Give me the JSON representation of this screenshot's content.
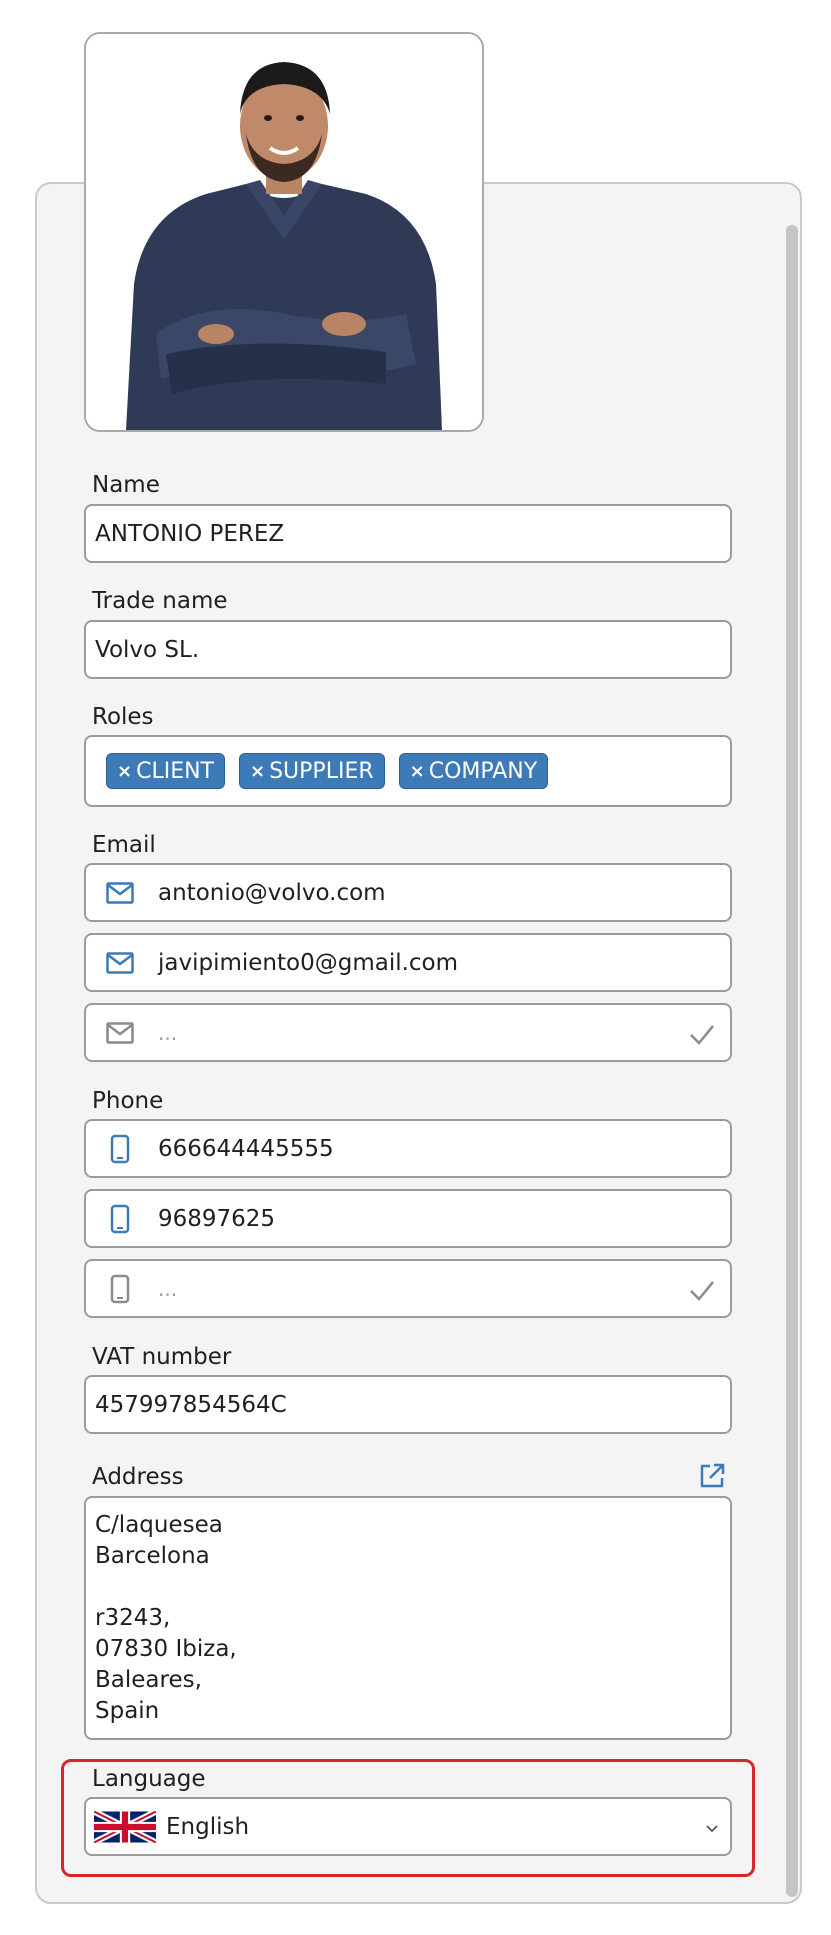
{
  "profile": {
    "photo_alt": "profile-photo"
  },
  "fields": {
    "name": {
      "label": "Name",
      "value": "ANTONIO PEREZ"
    },
    "trade_name": {
      "label": "Trade name",
      "value": "Volvo SL."
    },
    "roles": {
      "label": "Roles",
      "chips": [
        "CLIENT",
        "SUPPLIER",
        "COMPANY"
      ],
      "remove_glyph": "×"
    },
    "email": {
      "label": "Email",
      "entries": [
        "antonio@volvo.com",
        "javipimiento0@gmail.com"
      ],
      "new_placeholder": "..."
    },
    "phone": {
      "label": "Phone",
      "entries": [
        "666644445555",
        "96897625"
      ],
      "new_placeholder": "..."
    },
    "vat": {
      "label": "VAT number",
      "value": "457997854564C"
    },
    "address": {
      "label": "Address",
      "lines": [
        "C/laquesea",
        "Barcelona",
        "",
        "r3243,",
        "07830 Ibiza,",
        "Baleares,",
        "Spain"
      ]
    },
    "language": {
      "label": "Language",
      "selected": "English"
    }
  },
  "colors": {
    "accent": "#3d7ab8",
    "highlight": "#d9262b",
    "icon_inactive": "#8a8a8a"
  },
  "icons": {
    "email": "mail-icon",
    "phone": "mobile-phone-icon",
    "confirm": "check-icon",
    "external": "external-link-icon",
    "flag": "uk-flag-icon",
    "dropdown": "chevron-down-icon"
  }
}
